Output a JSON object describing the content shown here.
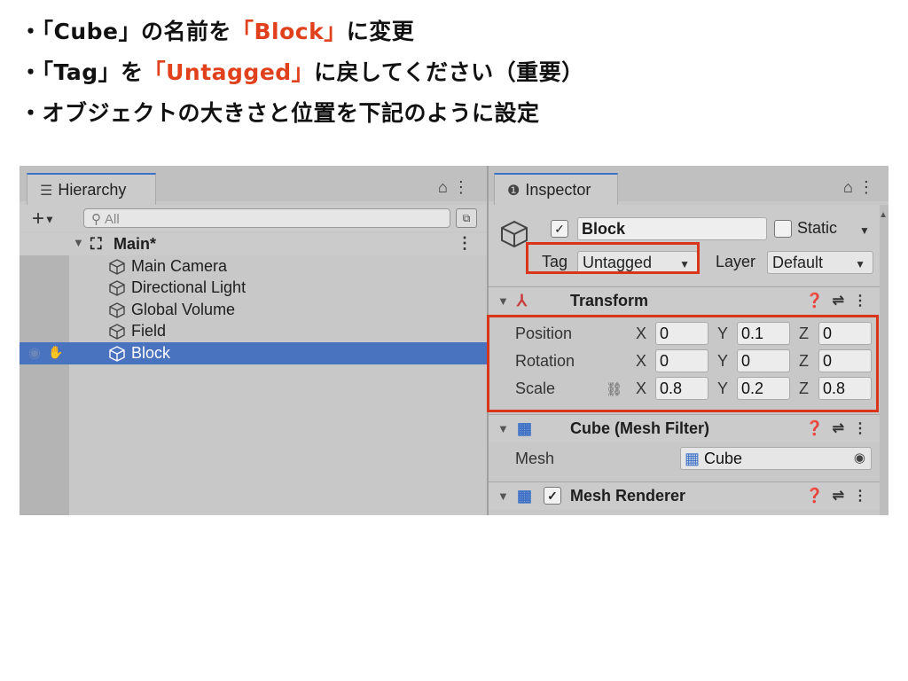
{
  "slide": {
    "bullet1": {
      "pre": "・「Cube」の名前を",
      "highlight": "「Block」",
      "post": "に変更"
    },
    "bullet2": {
      "pre": "・「Tag」を",
      "highlight": "「Untagged」",
      "post": "に戻してください（重要）"
    },
    "bullet3": {
      "text": "・オブジェクトの大きさと位置を下記のように設定"
    }
  },
  "hierarchy": {
    "tab_label": "Hierarchy",
    "search_placeholder": "All",
    "scene": "Main*",
    "items": [
      {
        "label": "Main Camera"
      },
      {
        "label": "Directional Light"
      },
      {
        "label": "Global Volume"
      },
      {
        "label": "Field"
      },
      {
        "label": "Block",
        "selected": true
      }
    ]
  },
  "inspector": {
    "tab_label": "Inspector",
    "object_name": "Block",
    "active": true,
    "static_label": "Static",
    "tag_label": "Tag",
    "tag_value": "Untagged",
    "layer_label": "Layer",
    "layer_value": "Default",
    "transform": {
      "title": "Transform",
      "position": {
        "label": "Position",
        "x": "0",
        "y": "0.1",
        "z": "0"
      },
      "rotation": {
        "label": "Rotation",
        "x": "0",
        "y": "0",
        "z": "0"
      },
      "scale": {
        "label": "Scale",
        "x": "0.8",
        "y": "0.2",
        "z": "0.8"
      }
    },
    "mesh_filter": {
      "title": "Cube (Mesh Filter)",
      "mesh_label": "Mesh",
      "mesh_value": "Cube"
    },
    "mesh_renderer": {
      "title": "Mesh Renderer"
    },
    "axis_labels": {
      "x": "X",
      "y": "Y",
      "z": "Z"
    }
  },
  "colors": {
    "highlight_red": "#e0401c",
    "box_red": "#d9351a",
    "selection_blue": "#4a73bf",
    "tab_accent": "#3a72c8"
  }
}
